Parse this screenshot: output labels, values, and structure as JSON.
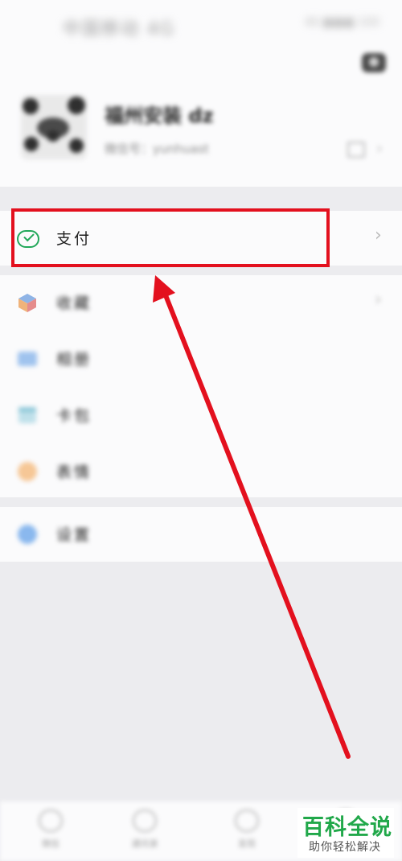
{
  "status_bar": {
    "title": "中国移动 4G",
    "right": "46 ■■■ 100"
  },
  "header": {
    "camera": "camera-icon"
  },
  "profile": {
    "name": "福州安装 dz",
    "wechat_id": "微信号：yunhuast",
    "qr": "qr-code-icon"
  },
  "menu": {
    "pay": {
      "label": "支付",
      "icon": "wechat-pay-icon",
      "color": "#22a85a"
    },
    "items": [
      {
        "label": "收藏",
        "icon": "favorites-icon"
      },
      {
        "label": "相册",
        "icon": "album-icon"
      },
      {
        "label": "卡包",
        "icon": "card-wallet-icon"
      },
      {
        "label": "表情",
        "icon": "sticker-icon"
      },
      {
        "label": "设置",
        "icon": "settings-icon"
      }
    ]
  },
  "tabbar": {
    "tabs": [
      {
        "label": "微信",
        "icon": "chat-icon"
      },
      {
        "label": "通讯录",
        "icon": "contacts-icon"
      },
      {
        "label": "发现",
        "icon": "discover-icon"
      },
      {
        "label": "我",
        "icon": "me-icon"
      }
    ]
  },
  "annotation": {
    "highlight_color": "#e3101e",
    "arrow_color": "#e3101e"
  },
  "watermark": {
    "title": "百科全说",
    "subtitle": "助你轻松解决",
    "color": "#21a84a"
  }
}
